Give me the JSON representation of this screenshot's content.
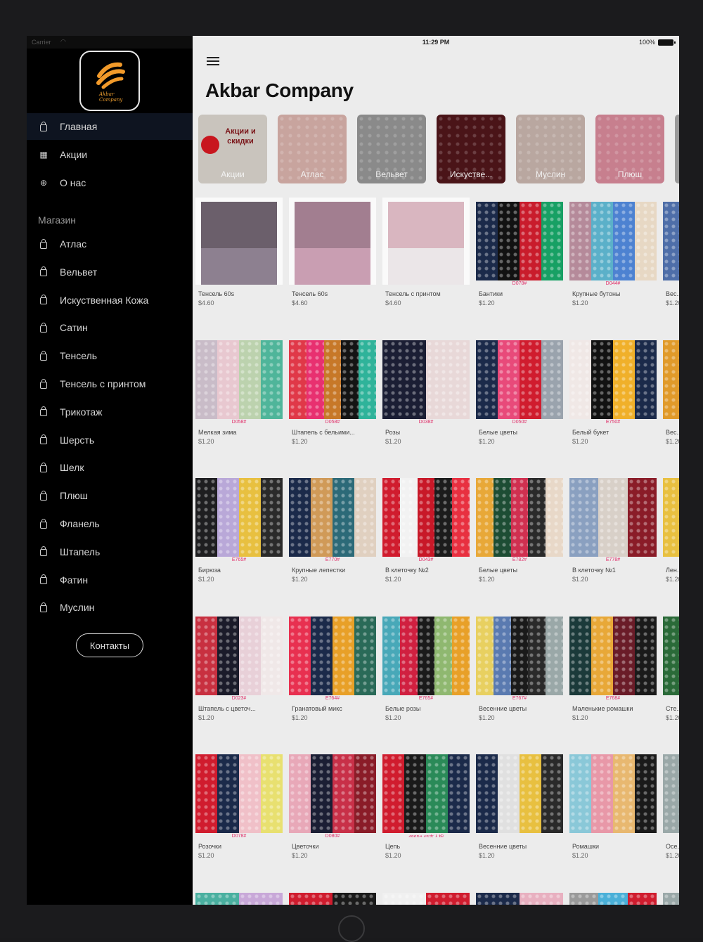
{
  "status_bar": {
    "carrier": "Carrier",
    "time": "11:29 PM",
    "battery": "100%"
  },
  "app": {
    "title": "Akbar Company",
    "logo_text": "Akbar Company"
  },
  "sidebar": {
    "top_items": [
      {
        "label": "Главная",
        "icon": "bag-icon"
      },
      {
        "label": "Акции",
        "icon": "calendar-icon"
      },
      {
        "label": "О нас",
        "icon": "globe-icon"
      }
    ],
    "section_title": "Магазин",
    "shop_items": [
      {
        "label": "Атлас"
      },
      {
        "label": "Вельвет"
      },
      {
        "label": "Искуственная Кожа"
      },
      {
        "label": "Сатин"
      },
      {
        "label": "Тенсель"
      },
      {
        "label": "Тенсель с принтом"
      },
      {
        "label": "Трикотаж"
      },
      {
        "label": "Шерсть"
      },
      {
        "label": "Шелк"
      },
      {
        "label": "Плюш"
      },
      {
        "label": "Фланель"
      },
      {
        "label": "Штапель"
      },
      {
        "label": "Фатин"
      },
      {
        "label": "Муслин"
      }
    ],
    "contacts_button": "Контакты"
  },
  "categories": [
    {
      "label": "Акции",
      "color": "#c9c4bd",
      "promo": "Акции и скидки"
    },
    {
      "label": "Атлас",
      "color": "#c8a49e"
    },
    {
      "label": "Вельвет",
      "color": "#8a8a8a"
    },
    {
      "label": "Искустве...",
      "color": "#4a1418"
    },
    {
      "label": "Муслин",
      "color": "#b9a7a0"
    },
    {
      "label": "Плюш",
      "color": "#c77f8e"
    }
  ],
  "products": [
    {
      "name": "Тенсель 60s",
      "price": "$4.60",
      "colors": [
        "#6b5f6b",
        "#8d8090"
      ],
      "code": ""
    },
    {
      "name": "Тенсель 60s",
      "price": "$4.60",
      "colors": [
        "#a27e90",
        "#c99eb2"
      ],
      "code": ""
    },
    {
      "name": "Тенсель с принтом",
      "price": "$4.60",
      "colors": [
        "#d9b6c0",
        "#ebe6e8"
      ],
      "code": ""
    },
    {
      "name": "Бантики",
      "price": "$1.20",
      "colors": [
        "#1b2a4a",
        "#121212",
        "#c91c2c",
        "#17a064"
      ],
      "code": "D078#"
    },
    {
      "name": "Крупные бутоны",
      "price": "$1.20",
      "colors": [
        "#b58a9a",
        "#5bb0c9",
        "#4d82d1",
        "#e7d8c4"
      ],
      "code": "D044#"
    },
    {
      "name": "Вес...",
      "price": "$1.20",
      "colors": [
        "#4e6ea8"
      ],
      "code": ""
    },
    {
      "name": "Мелкая зима",
      "price": "$1.20",
      "colors": [
        "#c9bcc8",
        "#e8c8d0",
        "#bcd2ae",
        "#4fb59a"
      ],
      "code": "D058#"
    },
    {
      "name": "Штапель с бельими...",
      "price": "$1.20",
      "colors": [
        "#e03848",
        "#e83070",
        "#c77828",
        "#141414",
        "#2fb39a"
      ],
      "code": "D058#"
    },
    {
      "name": "Розы",
      "price": "$1.20",
      "colors": [
        "#1b1e34",
        "#e8d8d8"
      ],
      "code": "D038#"
    },
    {
      "name": "Белые цветы",
      "price": "$1.20",
      "colors": [
        "#1b2a4a",
        "#e84a7a",
        "#d01c2e",
        "#9aa3ad"
      ],
      "code": "D050#"
    },
    {
      "name": "Белый букет",
      "price": "$1.20",
      "colors": [
        "#f0e8e6",
        "#121212",
        "#f0b02a",
        "#1b2a4a"
      ],
      "code": "E750#"
    },
    {
      "name": "Вес...",
      "price": "$1.20",
      "colors": [
        "#e09a2a"
      ],
      "code": ""
    },
    {
      "name": "Бирюза",
      "price": "$1.20",
      "colors": [
        "#1e1e20",
        "#b9a8d8",
        "#e8c040",
        "#2a2a2a"
      ],
      "code": "E765#"
    },
    {
      "name": "Крупные лепестки",
      "price": "$1.20",
      "colors": [
        "#1b2a4a",
        "#d09a58",
        "#2c6a78",
        "#e0d0c0"
      ],
      "code": "E770#"
    },
    {
      "name": "В клеточку №2",
      "price": "$1.20",
      "colors": [
        "#d01c2e",
        "#f2f2f2",
        "#c81828",
        "#1c1c1c",
        "#e83040"
      ],
      "code": "D043#"
    },
    {
      "name": "Белые цветы",
      "price": "$1.20",
      "colors": [
        "#e8a838",
        "#1d4d34",
        "#d03050",
        "#2a2a2a",
        "#e8d8c8"
      ],
      "code": "E782#"
    },
    {
      "name": "В клеточку №1",
      "price": "$1.20",
      "colors": [
        "#8aa0c0",
        "#d8d0c8",
        "#8a1c28"
      ],
      "code": "E778#"
    },
    {
      "name": "Лен...",
      "price": "$1.20",
      "colors": [
        "#e8c040"
      ],
      "code": ""
    },
    {
      "name": "Штапель с цветоч...",
      "price": "$1.20",
      "colors": [
        "#c83040",
        "#1b1b2a",
        "#e8d0d8",
        "#f0e8e8"
      ],
      "code": "D023#"
    },
    {
      "name": "Гранатовый микс",
      "price": "$1.20",
      "colors": [
        "#e83050",
        "#1b2a4a",
        "#e8a028",
        "#2a6a58"
      ],
      "code": "E764#"
    },
    {
      "name": "Белые розы",
      "price": "$1.20",
      "colors": [
        "#48a8b8",
        "#d02040",
        "#1a1a1a",
        "#8fb870",
        "#e8a028"
      ],
      "code": "E765#"
    },
    {
      "name": "Весенние цветы",
      "price": "$1.20",
      "colors": [
        "#e8d060",
        "#5a7ab0",
        "#1a1a1a",
        "#2a2a2a",
        "#9aa8a8"
      ],
      "code": "E767#"
    },
    {
      "name": "Маленькие ромашки",
      "price": "$1.20",
      "colors": [
        "#1b3a3a",
        "#e8a838",
        "#6a1c28",
        "#1a1a1a"
      ],
      "code": "E768#"
    },
    {
      "name": "Сте...",
      "price": "$1.20",
      "colors": [
        "#2a6a38"
      ],
      "code": ""
    },
    {
      "name": "Розочки",
      "price": "$1.20",
      "colors": [
        "#d01c2e",
        "#1b2a4a",
        "#f0c0c8",
        "#e8e070"
      ],
      "code": "D078#"
    },
    {
      "name": "Цветочки",
      "price": "$1.20",
      "colors": [
        "#e8a8b8",
        "#1b1e34",
        "#c83048",
        "#8a1c28"
      ],
      "code": "D080#"
    },
    {
      "name": "Цепь",
      "price": "$1.20",
      "colors": [
        "#d01c2e",
        "#1a1a1a",
        "#2a8a58",
        "#1b2a4a"
      ],
      "code": "4865# 45支人棉"
    },
    {
      "name": "Весенние цветы",
      "price": "$1.20",
      "colors": [
        "#1b2a4a",
        "#e0e0e0",
        "#e8c040",
        "#2a2a2a"
      ],
      "code": ""
    },
    {
      "name": "Ромашки",
      "price": "$1.20",
      "colors": [
        "#8ac8d8",
        "#e898a8",
        "#e8b870",
        "#1a1a1a"
      ],
      "code": ""
    },
    {
      "name": "Осе...",
      "price": "$1.20",
      "colors": [
        "#9aa8a8"
      ],
      "code": ""
    },
    {
      "name": "",
      "price": "",
      "colors": [
        "#4ab0a0",
        "#c8a8d8"
      ],
      "code": ""
    },
    {
      "name": "",
      "price": "",
      "colors": [
        "#d01c2e",
        "#1a1a1a"
      ],
      "code": ""
    },
    {
      "name": "",
      "price": "",
      "colors": [
        "#f0f0f0",
        "#d01c2e"
      ],
      "code": ""
    },
    {
      "name": "",
      "price": "",
      "colors": [
        "#1b2a4a",
        "#e8b0c0"
      ],
      "code": ""
    },
    {
      "name": "",
      "price": "",
      "colors": [
        "#9a9a9a",
        "#4ab0d8",
        "#d01c2e"
      ],
      "code": ""
    },
    {
      "name": "",
      "price": "",
      "colors": [
        "#9aa8a8"
      ],
      "code": ""
    }
  ]
}
